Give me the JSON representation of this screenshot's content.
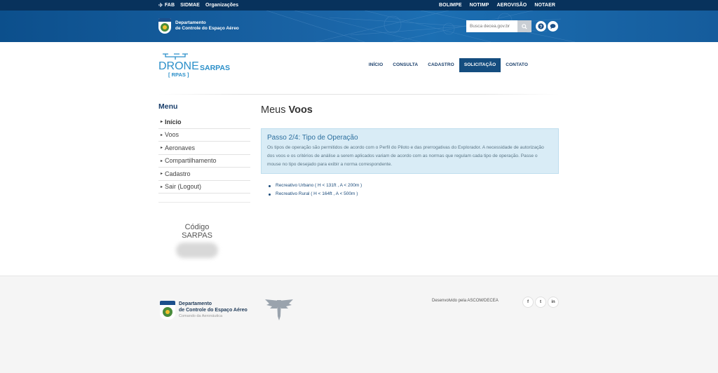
{
  "topbar": {
    "left_links": [
      "FAB",
      "SIDMAE",
      "Organizações"
    ],
    "right_links": [
      "BOLIMPE",
      "NOTIMP",
      "AEROVISÃO",
      "NOTAER"
    ]
  },
  "header": {
    "org_line1": "Departamento",
    "org_line2": "de Controle do Espaço Aéreo",
    "search_placeholder": "Busca decea.gov.br"
  },
  "logo": {
    "word1": "DRONE",
    "word2": "SARPAS",
    "sub": "[ RPAS ]"
  },
  "nav": {
    "items": [
      {
        "label": "INÍCIO",
        "active": false
      },
      {
        "label": "CONSULTA",
        "active": false
      },
      {
        "label": "CADASTRO",
        "active": false
      },
      {
        "label": "SOLICITAÇÃO",
        "active": true
      },
      {
        "label": "CONTATO",
        "active": false
      }
    ]
  },
  "sidebar": {
    "title": "Menu",
    "items": [
      {
        "label": "Início"
      },
      {
        "label": "Voos"
      },
      {
        "label": "Aeronaves"
      },
      {
        "label": "Compartilhamento"
      },
      {
        "label": "Cadastro"
      },
      {
        "label": "Sair (Logout)"
      }
    ],
    "codigo_line1": "Código",
    "codigo_line2": "SARPAS"
  },
  "main": {
    "title_normal": "Meus ",
    "title_bold": "Voos",
    "step_title": "Passo 2/4: Tipo de Operação",
    "step_text": "Os tipos de operação são permitidos de acordo com o Perfil do Piloto e das prerrogativas do Explorador. A necessidade de autorização dos voos e os critérios de análise a serem aplicados variam de acordo com as normas que regulam cada tipo de operação. Passe o mouse no tipo desejado para exibir a norma correspondente.",
    "options": [
      {
        "label": "Recreativo Urbano ( H < 131ft , A < 200m )"
      },
      {
        "label": "Recreativo Rural ( H < 164ft , A < 500m )"
      }
    ]
  },
  "footer": {
    "org_line1": "Departamento",
    "org_line2": "de Controle do Espaço Aéreo",
    "org_line3": "Comando da Aeronáutica",
    "developed_by": "Desenvolvido pela ASCOM/DECEA",
    "social": [
      "f",
      "t",
      "in"
    ]
  },
  "colors": {
    "topbar": "#08325c",
    "header": "#1a64a6",
    "nav_active": "#144d7f",
    "info_bg": "#d9ecf6",
    "info_title": "#2d6f9e",
    "link": "#1a4a7a"
  }
}
